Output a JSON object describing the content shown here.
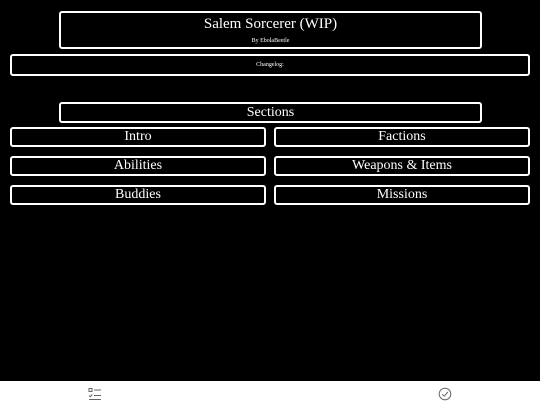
{
  "header": {
    "title": "Salem Sorcerer (WIP)",
    "byline": "By EbolaBeetle"
  },
  "changelog_label": "Changelog:",
  "sections_heading": "Sections",
  "sections": {
    "intro": "Intro",
    "factions": "Factions",
    "abilities": "Abilities",
    "weapons_items": "Weapons & Items",
    "buddies": "Buddies",
    "missions": "Missions"
  },
  "bottom_bar": {
    "left_icon": "checklist-icon",
    "right_icon": "check-circle-icon"
  },
  "colors": {
    "background": "#000000",
    "foreground": "#ffffff",
    "bar": "#ffffff",
    "bar_icon": "#666666"
  }
}
